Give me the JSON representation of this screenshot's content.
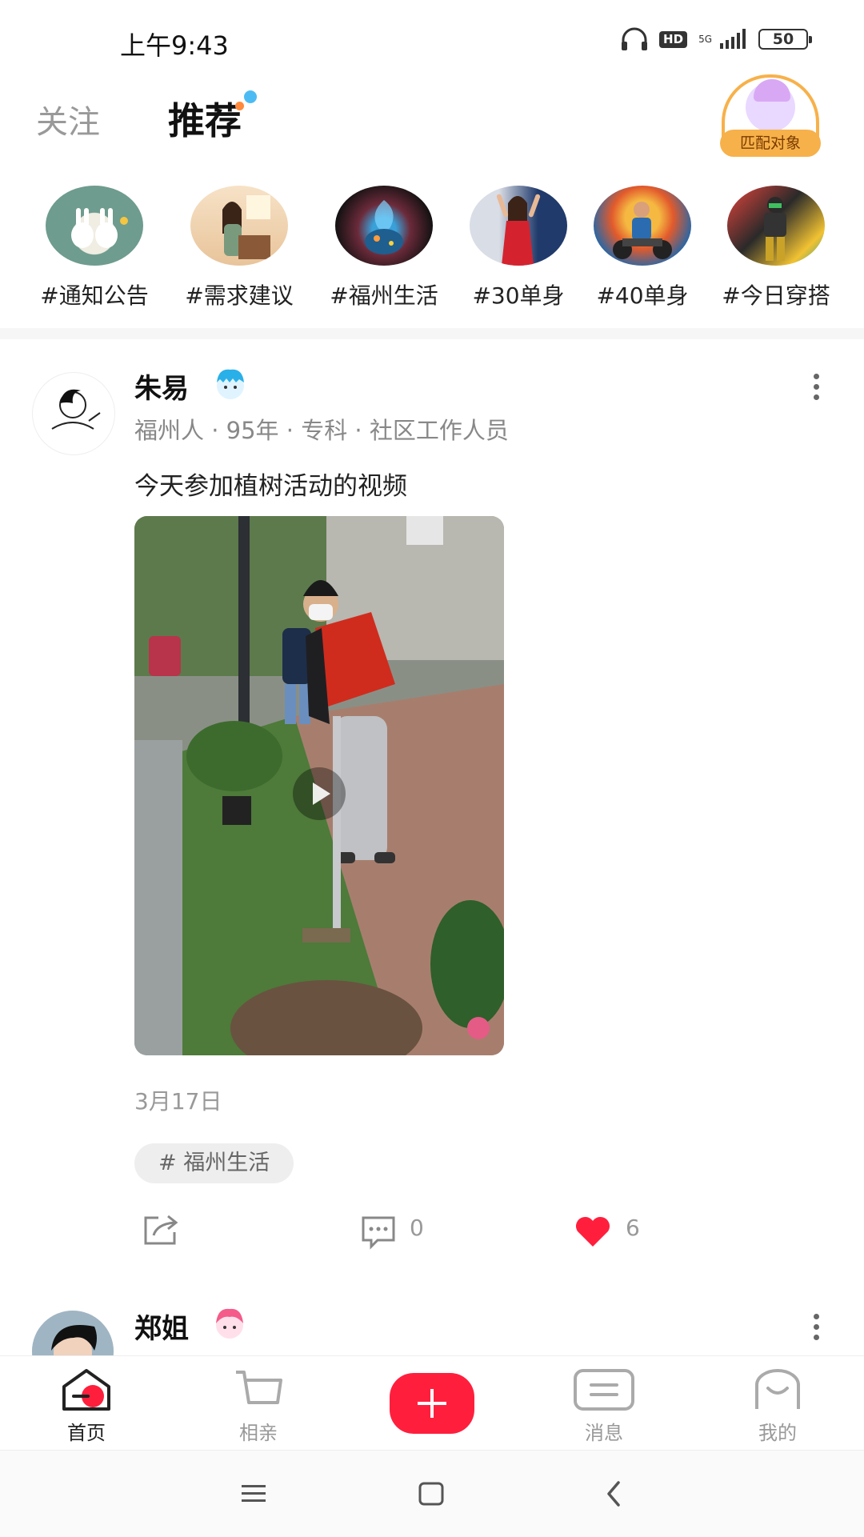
{
  "status_bar": {
    "time": "上午9:43",
    "hd": "HD",
    "network": "5G",
    "battery": "50"
  },
  "tabs": {
    "follow": "关注",
    "recommend": "推荐"
  },
  "match_button": {
    "label": "匹配对象"
  },
  "topics": [
    "#通知公告",
    "#需求建议",
    "#福州生活",
    "#30单身",
    "#40单身",
    "#今日穿搭"
  ],
  "post": {
    "author": "朱易",
    "meta": "福州人 · 95年 · 专科 · 社区工作人员",
    "text": "今天参加植树活动的视频",
    "date": "3月17日",
    "tag": "# 福州生活",
    "comment_count": "0",
    "like_count": "6"
  },
  "next_post": {
    "author": "郑姐"
  },
  "bottom_nav": {
    "home": "首页",
    "dating": "相亲",
    "messages": "消息",
    "mine": "我的"
  },
  "colors": {
    "accent": "#ff1f3d",
    "like": "#ff1f3d",
    "match_border": "#f7b14a"
  }
}
